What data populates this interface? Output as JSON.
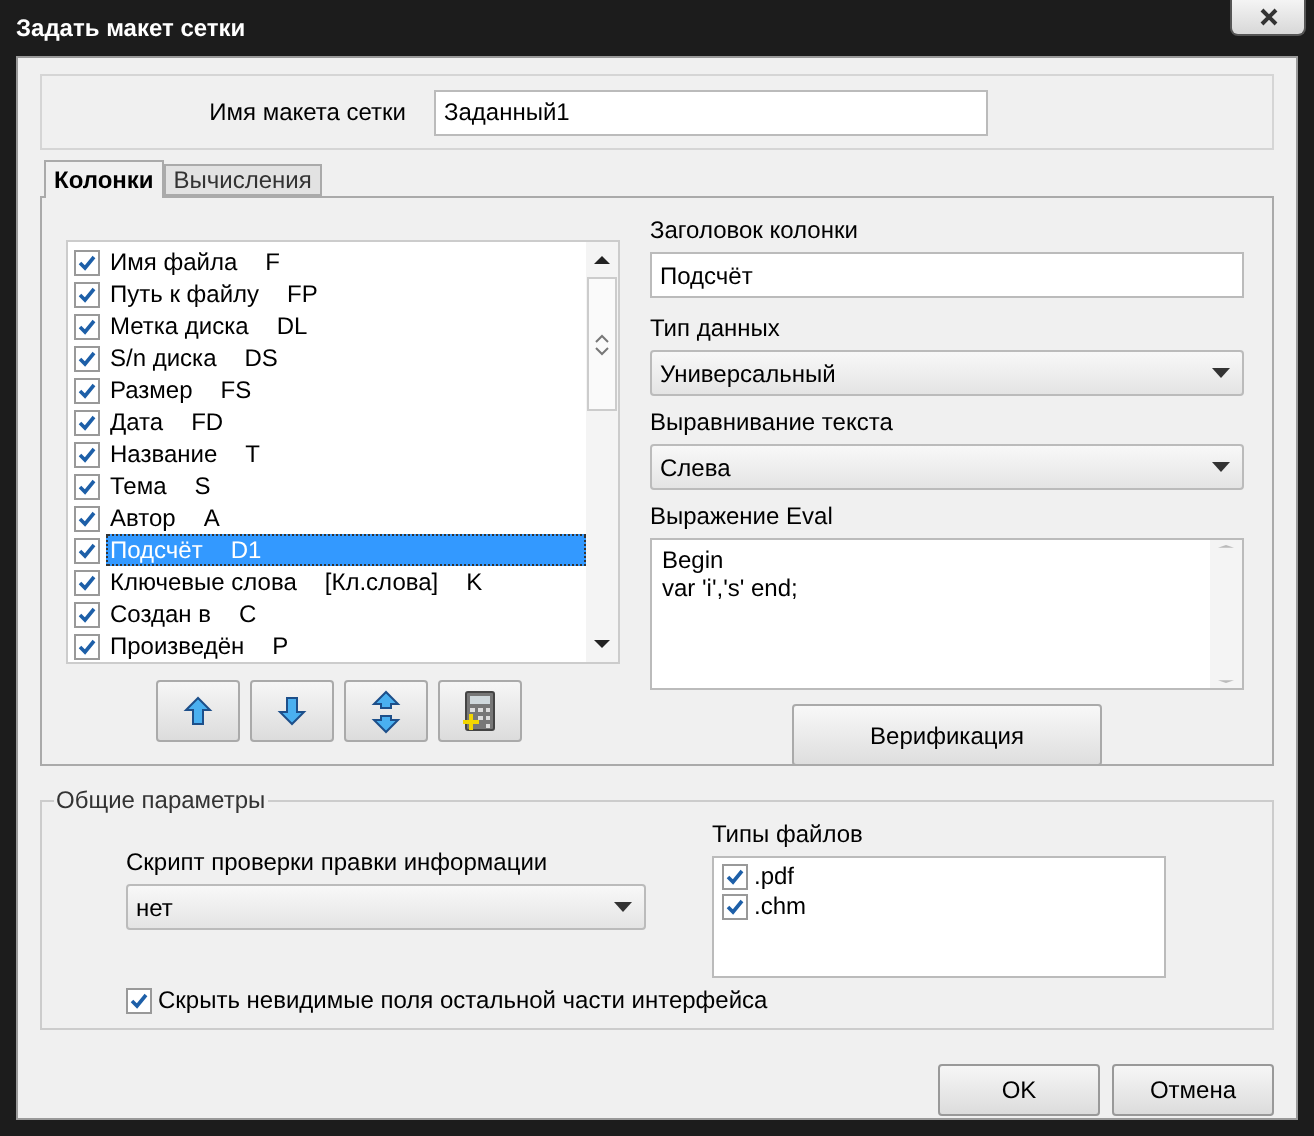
{
  "window": {
    "title": "Задать макет сетки"
  },
  "layout_name": {
    "label": "Имя макета сетки",
    "value": "Заданный1"
  },
  "tabs": [
    {
      "label": "Колонки",
      "selected": true
    },
    {
      "label": "Вычисления",
      "selected": false
    }
  ],
  "columns": [
    {
      "name": "Имя файла",
      "code": "F",
      "checked": true,
      "selected": false
    },
    {
      "name": "Путь к файлу",
      "code": "FP",
      "checked": true,
      "selected": false
    },
    {
      "name": "Метка диска",
      "code": "DL",
      "checked": true,
      "selected": false
    },
    {
      "name": "S/n диска",
      "code": "DS",
      "checked": true,
      "selected": false
    },
    {
      "name": "Размер",
      "code": "FS",
      "checked": true,
      "selected": false
    },
    {
      "name": "Дата",
      "code": "FD",
      "checked": true,
      "selected": false
    },
    {
      "name": "Название",
      "code": "T",
      "checked": true,
      "selected": false
    },
    {
      "name": "Тема",
      "code": "S",
      "checked": true,
      "selected": false
    },
    {
      "name": "Автор",
      "code": "A",
      "checked": true,
      "selected": false
    },
    {
      "name": "Подсчёт",
      "code": "D1",
      "checked": true,
      "selected": true
    },
    {
      "name": "Ключевые слова",
      "alias": "[Кл.слова]",
      "code": "K",
      "checked": true,
      "selected": false
    },
    {
      "name": "Создан в",
      "code": "C",
      "checked": true,
      "selected": false
    },
    {
      "name": "Произведён",
      "code": "P",
      "checked": true,
      "selected": false
    }
  ],
  "column_header": {
    "label": "Заголовок колонки",
    "value": "Подсчёт"
  },
  "data_type": {
    "label": "Тип данных",
    "value": "Универсальный"
  },
  "alignment": {
    "label": "Выравнивание текста",
    "value": "Слева"
  },
  "eval": {
    "label": "Выражение Eval",
    "lines": [
      "Begin",
      "var 'i','s' end;"
    ]
  },
  "verify_button": "Верификация",
  "general": {
    "title": "Общие параметры",
    "script": {
      "label": "Скрипт проверки правки информации",
      "value": "нет"
    },
    "file_types": {
      "label": "Типы файлов",
      "items": [
        {
          "label": ".pdf",
          "checked": true
        },
        {
          "label": ".chm",
          "checked": true
        }
      ]
    },
    "hide_fields": {
      "label": "Скрыть невидимые поля остальной части интерфейса",
      "checked": true
    }
  },
  "buttons": [
    "OK",
    "Отмена"
  ]
}
